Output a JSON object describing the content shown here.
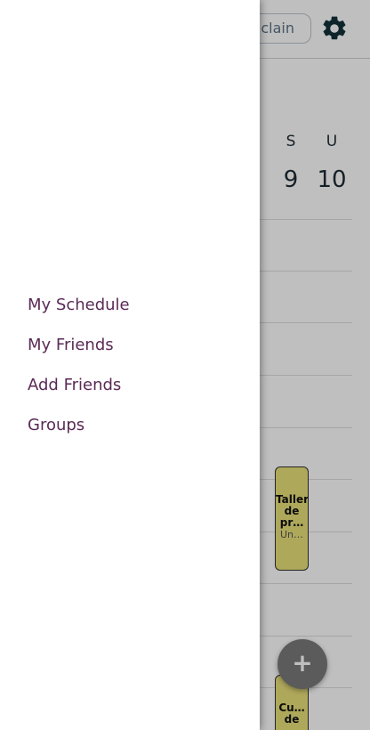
{
  "header": {
    "user_label": "clain"
  },
  "calendar": {
    "days": [
      {
        "letter": "S",
        "number": "9"
      },
      {
        "letter": "U",
        "number": "10"
      }
    ],
    "events": [
      {
        "title": "Taller de pr…",
        "subtitle": "Un…"
      },
      {
        "title": "Cu… de",
        "subtitle": ""
      }
    ]
  },
  "fab": {
    "label": "+"
  },
  "drawer": {
    "items": [
      {
        "label": "My Schedule"
      },
      {
        "label": "My Friends"
      },
      {
        "label": "Add Friends"
      },
      {
        "label": "Groups"
      }
    ]
  },
  "colors": {
    "menu_text": "#5a2a55",
    "event_fill": "#e9e07a",
    "fab_fill": "#7a7a7a"
  }
}
